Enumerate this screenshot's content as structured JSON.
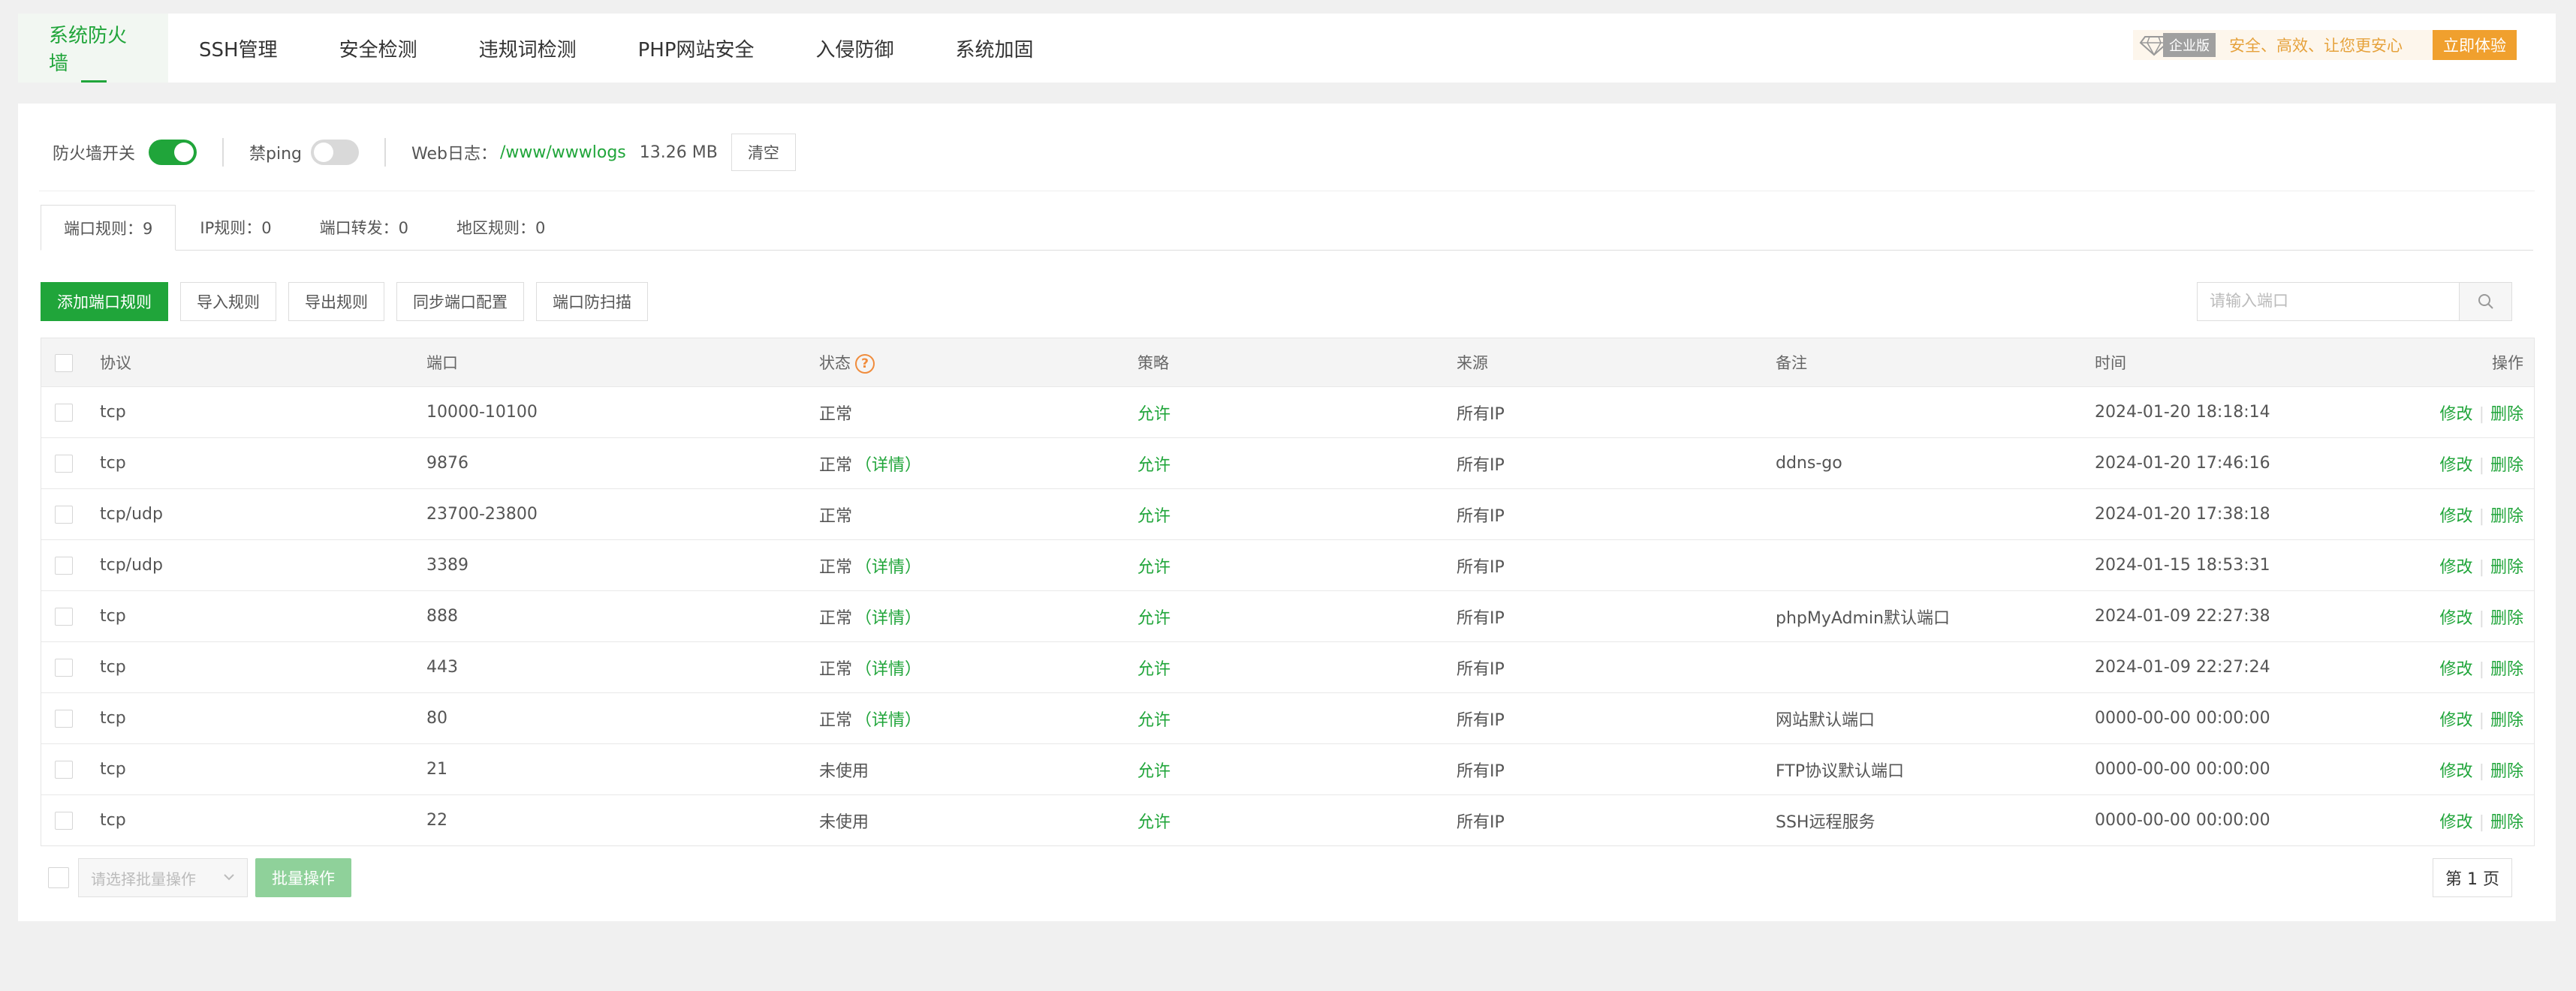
{
  "nav": {
    "tabs": [
      "系统防火墙",
      "SSH管理",
      "安全检测",
      "违规词检测",
      "PHP网站安全",
      "入侵防御",
      "系统加固"
    ],
    "active_index": 0,
    "pro": {
      "edition": "企业版",
      "slogan": "安全、高效、让您更安心",
      "cta": "立即体验"
    }
  },
  "settings": {
    "firewall_label": "防火墙开关",
    "firewall_on": true,
    "ping_label": "禁ping",
    "ping_on": false,
    "weblog_label": "Web日志：",
    "weblog_path": "/www/wwwlogs",
    "weblog_size": "13.26 MB",
    "clear_label": "清空"
  },
  "subtabs": [
    {
      "label": "端口规则：9",
      "active": true
    },
    {
      "label": "IP规则：0",
      "active": false
    },
    {
      "label": "端口转发：0",
      "active": false
    },
    {
      "label": "地区规则：0",
      "active": false
    }
  ],
  "toolbar": {
    "add": "添加端口规则",
    "import": "导入规则",
    "export": "导出规则",
    "sync": "同步端口配置",
    "scan": "端口防扫描",
    "search_placeholder": "请输入端口"
  },
  "table": {
    "headers": {
      "protocol": "协议",
      "port": "端口",
      "state": "状态",
      "policy": "策略",
      "source": "来源",
      "note": "备注",
      "time": "时间",
      "ops": "操作"
    },
    "state_help": "?",
    "detail_label": "（详情）",
    "edit_label": "修改",
    "delete_label": "删除",
    "rows": [
      {
        "protocol": "tcp",
        "port": "10000-10100",
        "state": "正常",
        "detail": false,
        "policy": "允许",
        "source": "所有IP",
        "note": "",
        "time": "2024-01-20 18:18:14"
      },
      {
        "protocol": "tcp",
        "port": "9876",
        "state": "正常",
        "detail": true,
        "policy": "允许",
        "source": "所有IP",
        "note": "ddns-go",
        "time": "2024-01-20 17:46:16"
      },
      {
        "protocol": "tcp/udp",
        "port": "23700-23800",
        "state": "正常",
        "detail": false,
        "policy": "允许",
        "source": "所有IP",
        "note": "",
        "time": "2024-01-20 17:38:18"
      },
      {
        "protocol": "tcp/udp",
        "port": "3389",
        "state": "正常",
        "detail": true,
        "policy": "允许",
        "source": "所有IP",
        "note": "",
        "time": "2024-01-15 18:53:31"
      },
      {
        "protocol": "tcp",
        "port": "888",
        "state": "正常",
        "detail": true,
        "policy": "允许",
        "source": "所有IP",
        "note": "phpMyAdmin默认端口",
        "time": "2024-01-09 22:27:38"
      },
      {
        "protocol": "tcp",
        "port": "443",
        "state": "正常",
        "detail": true,
        "policy": "允许",
        "source": "所有IP",
        "note": "",
        "time": "2024-01-09 22:27:24"
      },
      {
        "protocol": "tcp",
        "port": "80",
        "state": "正常",
        "detail": true,
        "policy": "允许",
        "source": "所有IP",
        "note": "网站默认端口",
        "time": "0000-00-00 00:00:00"
      },
      {
        "protocol": "tcp",
        "port": "21",
        "state": "未使用",
        "detail": false,
        "policy": "允许",
        "source": "所有IP",
        "note": "FTP协议默认端口",
        "time": "0000-00-00 00:00:00"
      },
      {
        "protocol": "tcp",
        "port": "22",
        "state": "未使用",
        "detail": false,
        "policy": "允许",
        "source": "所有IP",
        "note": "SSH远程服务",
        "time": "0000-00-00 00:00:00"
      }
    ]
  },
  "footer": {
    "batch_select_placeholder": "请选择批量操作",
    "batch_button": "批量操作",
    "page_label": "第 1 页"
  },
  "colors": {
    "accent": "#20a53a",
    "pro_orange": "#f0a02e"
  }
}
